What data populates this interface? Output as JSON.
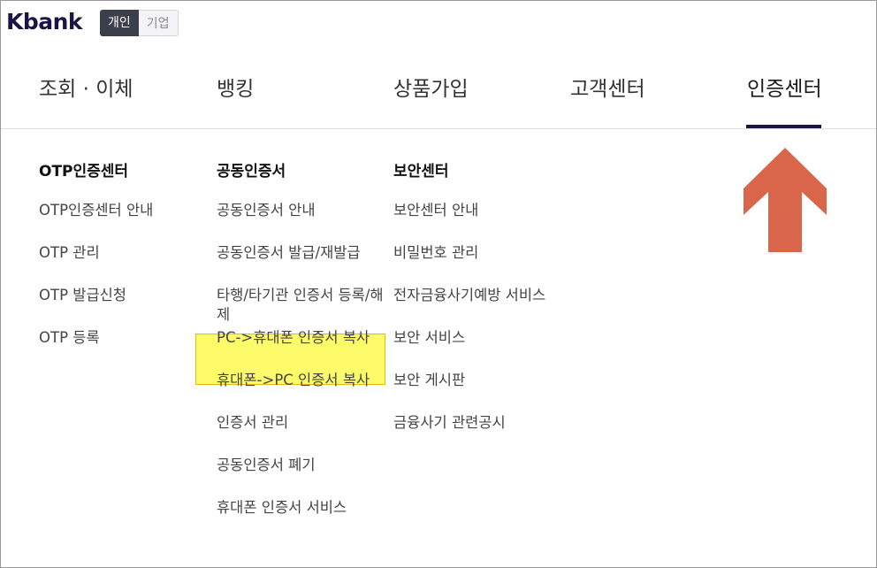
{
  "brand": {
    "logo": "Kbank"
  },
  "segment": {
    "personal": "개인",
    "business": "기업"
  },
  "nav": {
    "items": [
      "조회 · 이체",
      "뱅킹",
      "상품가입",
      "고객센터",
      "인증센터"
    ],
    "active_index": 4
  },
  "menu": {
    "otp": {
      "heading": "OTP인증센터",
      "items": [
        "OTP인증센터 안내",
        "OTP 관리",
        "OTP 발급신청",
        "OTP 등록"
      ]
    },
    "cert": {
      "heading": "공동인증서",
      "items": [
        "공동인증서 안내",
        "공동인증서 발급/재발급",
        "타행/타기관 인증서 등록/해제",
        "PC->휴대폰 인증서 복사",
        "휴대폰->PC 인증서 복사",
        "인증서 관리",
        "공동인증서 폐기",
        "휴대폰 인증서 서비스"
      ],
      "highlighted_index": 3
    },
    "security": {
      "heading": "보안센터",
      "items": [
        "보안센터 안내",
        "비밀번호 관리",
        "전자금융사기예방 서비스",
        "보안 서비스",
        "보안 게시판",
        "금융사기 관련공시"
      ]
    }
  },
  "colors": {
    "brand": "#1c1446",
    "arrow": "#d9654a",
    "highlight": "#fdfb6a"
  },
  "annotation": {
    "arrow_icon": "up-arrow-icon"
  }
}
